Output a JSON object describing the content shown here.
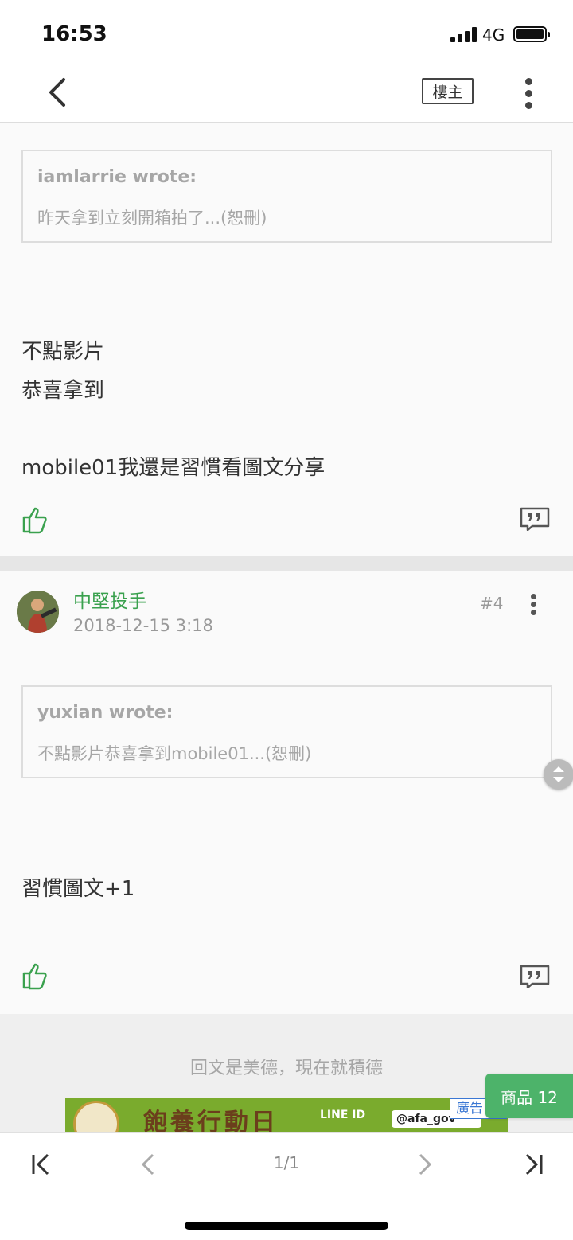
{
  "status_bar": {
    "time": "16:53",
    "network": "4G"
  },
  "header": {
    "owner_label": "樓主"
  },
  "posts": [
    {
      "quote": {
        "author": "iamlarrie wrote:",
        "text": "昨天拿到立刻開箱拍了...(恕刪)"
      },
      "body": [
        "不點影片",
        "恭喜拿到",
        "",
        "mobile01我還是習慣看圖文分享"
      ]
    },
    {
      "username": "中堅投手",
      "timestamp": "2018-12-15 3:18",
      "floor": "#4",
      "quote": {
        "author": "yuxian wrote:",
        "text": "不點影片恭喜拿到mobile01...(恕刪)"
      },
      "body": [
        "習慣圖文+1"
      ]
    }
  ],
  "reply_prompt": "回文是美德，現在就積德",
  "ad": {
    "title": "飽養行動日",
    "line_label": "LINE ID",
    "handle": "@afa_gov",
    "tag": "廣告"
  },
  "products_button": "商品 12",
  "pager": {
    "page_label": "1/1"
  },
  "colors": {
    "accent_green": "#3aa14e",
    "products_green": "#4db36a"
  }
}
